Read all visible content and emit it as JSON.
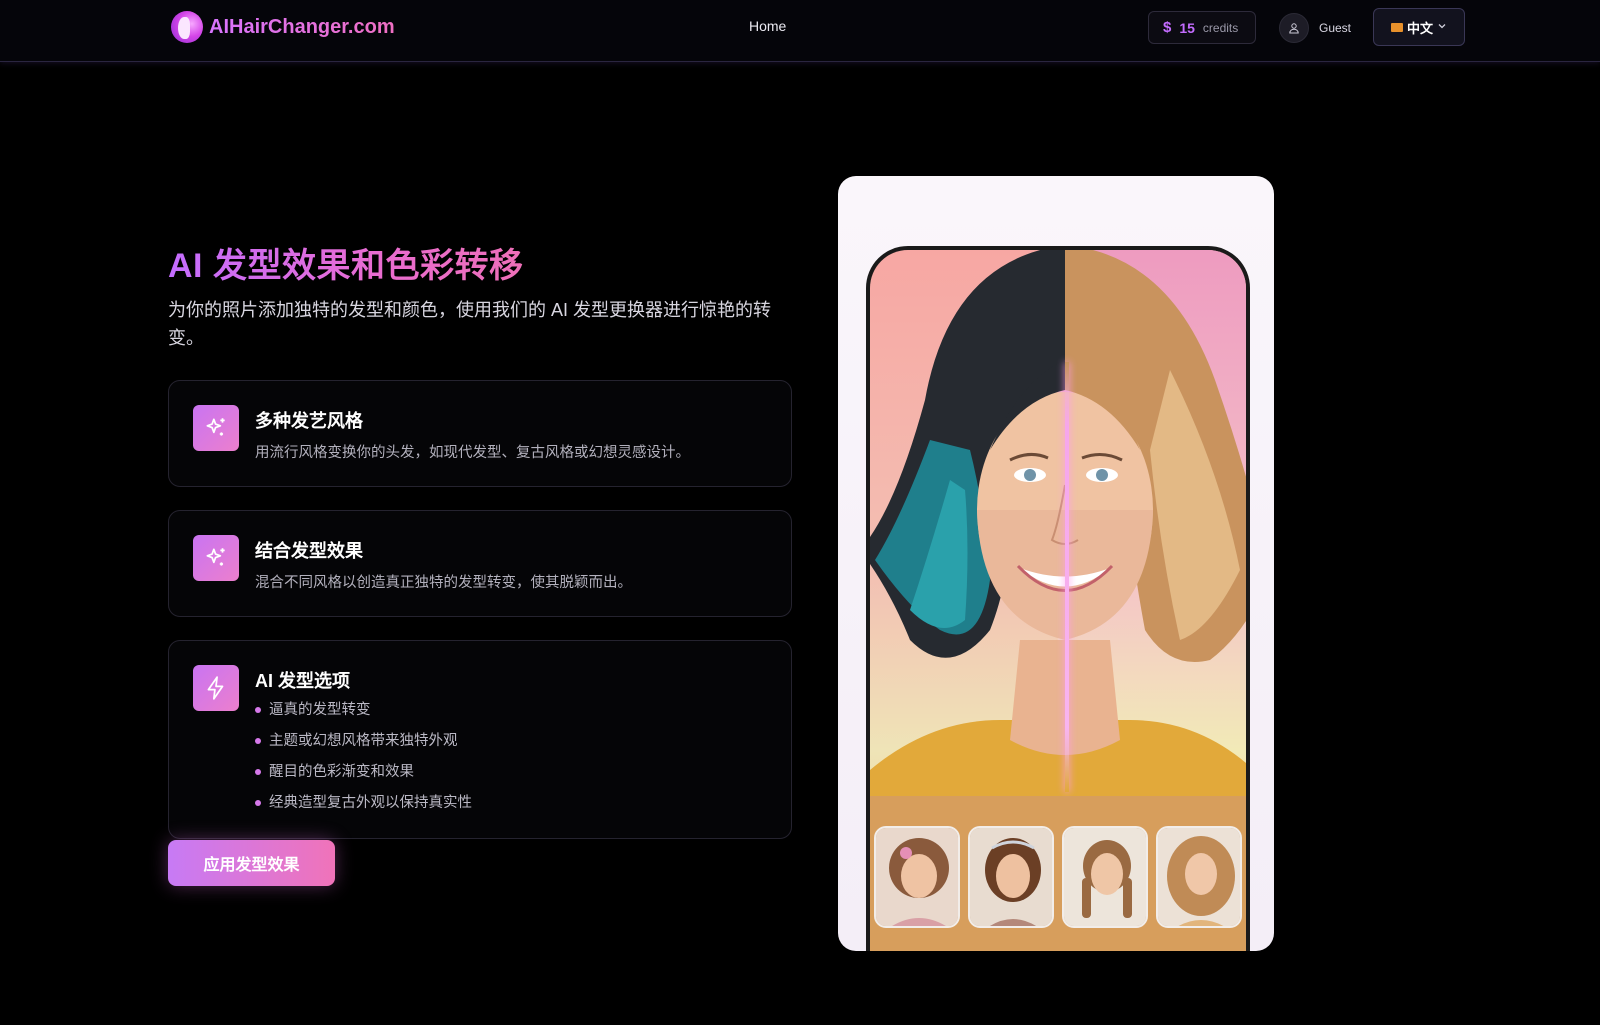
{
  "header": {
    "logo_text": "AIHairChanger.com",
    "nav_home": "Home",
    "credits_symbol": "$",
    "credits_count": "15",
    "credits_label": "credits",
    "user_name": "Guest",
    "language": "中文"
  },
  "hero": {
    "title": "AI 发型效果和色彩转移",
    "subtitle": "为你的照片添加独特的发型和颜色，使用我们的 AI 发型更换器进行惊艳的转变。"
  },
  "features": [
    {
      "title": "多种发艺风格",
      "description": "用流行风格变换你的头发，如现代发型、复古风格或幻想灵感设计。",
      "icon": "sparkles-icon"
    },
    {
      "title": "结合发型效果",
      "description": "混合不同风格以创造真正独特的发型转变，使其脱颖而出。",
      "icon": "sparkles-icon"
    },
    {
      "title": "AI 发型选项",
      "icon": "lightning-icon",
      "bullets": [
        "逼真的发型转变",
        "主题或幻想风格带来独特外观",
        "醒目的色彩渐变和效果",
        "经典造型复古外观以保持真实性"
      ]
    }
  ],
  "cta_label": "应用发型效果",
  "colors": {
    "accent_purple": "#c46dff",
    "accent_pink": "#ee6fb8",
    "background": "#000000"
  }
}
